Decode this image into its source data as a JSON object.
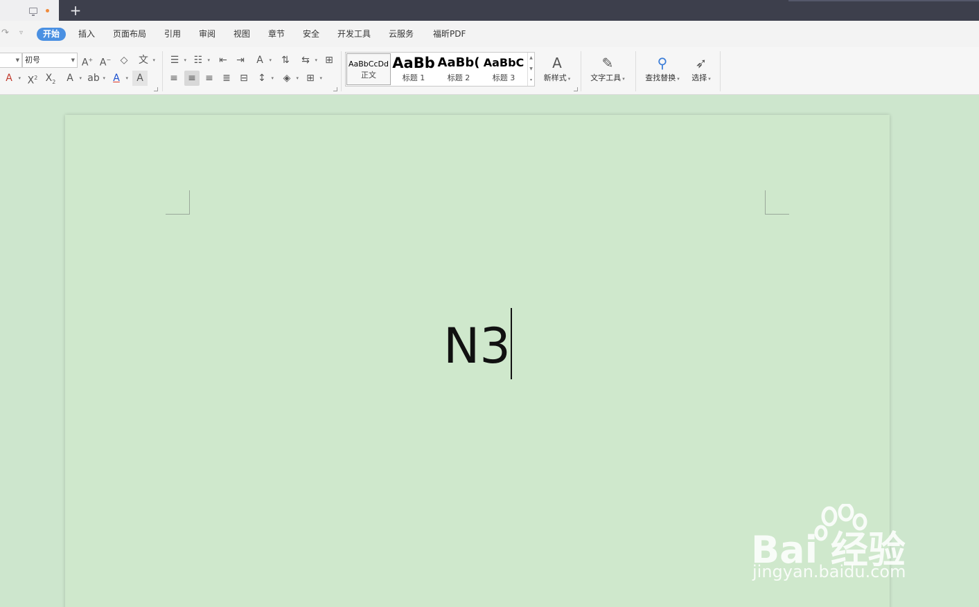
{
  "titlebar": {
    "new_tab": "+"
  },
  "menu": {
    "items": [
      "开始",
      "插入",
      "页面布局",
      "引用",
      "审阅",
      "视图",
      "章节",
      "安全",
      "开发工具",
      "云服务",
      "福昕PDF"
    ],
    "active_index": 0
  },
  "ribbon": {
    "font_size_value": "初号",
    "styles": [
      {
        "sample": "AaBbCcDd",
        "name": "正文"
      },
      {
        "sample": "AaBb",
        "name": "标题 1"
      },
      {
        "sample": "AaBb(",
        "name": "标题 2"
      },
      {
        "sample": "AaBbC",
        "name": "标题 3"
      }
    ],
    "new_style": "新样式",
    "text_tools": "文字工具",
    "find_replace": "查找替换",
    "select": "选择"
  },
  "document": {
    "text": "N3"
  },
  "watermark": {
    "main": "Bai  经验",
    "sub": "jingyan.baidu.com"
  }
}
